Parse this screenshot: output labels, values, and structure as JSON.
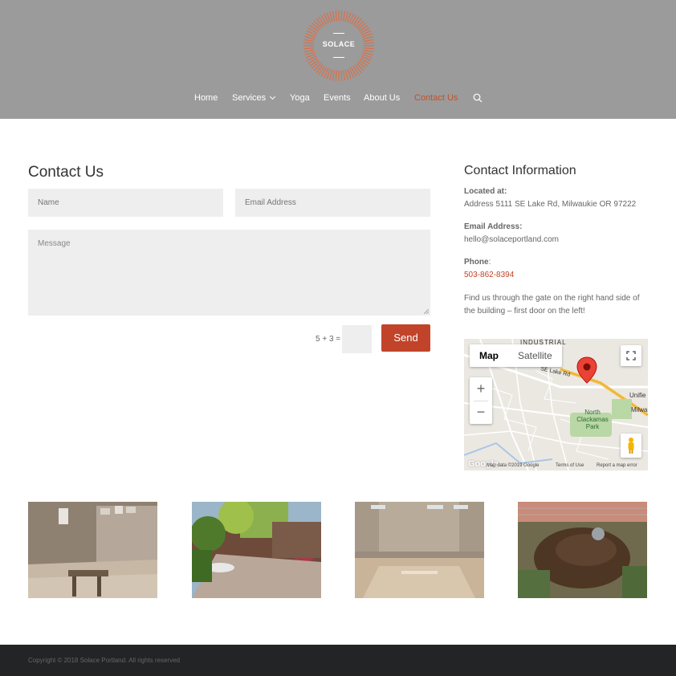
{
  "brand": {
    "logo_text": "SOLACE",
    "accent_color": "#c1512a"
  },
  "nav": {
    "items": [
      {
        "label": "Home"
      },
      {
        "label": "Services"
      },
      {
        "label": "Yoga"
      },
      {
        "label": "Events"
      },
      {
        "label": "About Us"
      },
      {
        "label": "Contact Us",
        "active": true
      }
    ],
    "search_icon": "search-icon"
  },
  "contact_form": {
    "title": "Contact Us",
    "name_placeholder": "Name",
    "email_placeholder": "Email Address",
    "message_placeholder": "Message",
    "captcha_label": "5 + 3 =",
    "send_label": "Send"
  },
  "contact_info": {
    "title": "Contact Information",
    "located_label": "Located at:",
    "address": "Address 5111 SE Lake Rd, Milwaukie OR 97222",
    "email_label": "Email Address:",
    "email": "hello@solaceportland.com",
    "phone_label": "Phone",
    "phone_colon": ":",
    "phone": "503-862-8394",
    "note": "Find us through the gate on the right hand side of the building – first door on the left!"
  },
  "map": {
    "type_map": "Map",
    "type_satellite": "Satellite",
    "zoom_in": "+",
    "zoom_out": "−",
    "labels": {
      "industrial": "INDUSTRIAL",
      "road": "SE Lake Rd",
      "unified": "Unifie",
      "milwa": "Milwa",
      "park_line1": "North",
      "park_line2": "Clackamas",
      "park_line3": "Park"
    },
    "logo": "Google",
    "attribution": "Map data ©2019 Google",
    "terms": "Terms of Use",
    "report": "Report a map error"
  },
  "footer": {
    "copyright": "Copyright © 2018 Solace Portland. All rights reserved"
  }
}
